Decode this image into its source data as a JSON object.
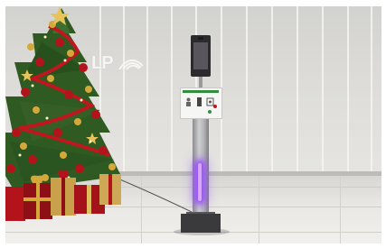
{
  "scene": {
    "logo_text": "LP",
    "accent_colors": {
      "tree_green": "#2f5a22",
      "ornament_red": "#b3141c",
      "ornament_gold": "#d4a93a",
      "kiosk_light": "#9a4dff",
      "sign_green": "#2f8f3d"
    }
  }
}
